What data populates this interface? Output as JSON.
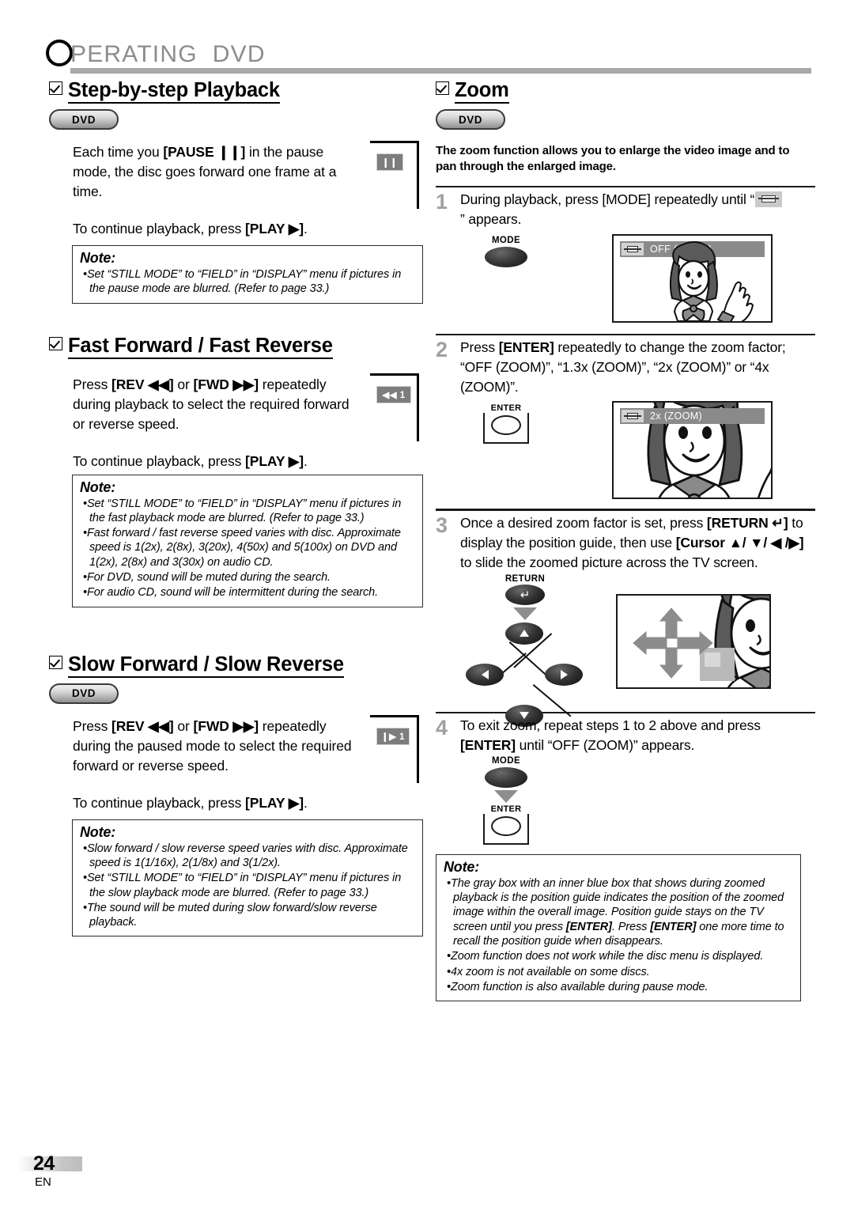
{
  "page": {
    "header_title": "PERATING  DVD",
    "header_initial": "O",
    "footer_page": "24",
    "footer_lang": "EN"
  },
  "left_column": {
    "sections": [
      {
        "title": "Step-by-step Playback",
        "badge": "DVD",
        "paragraphs": [
          "Each time you [PAUSE ❙❙] in the pause mode, the disc goes forward one frame at a time.",
          "To continue playback, press [PLAY ▶]."
        ],
        "key_chip": "❙❙",
        "note": {
          "title": "Note:",
          "items": [
            "Set “STILL MODE” to “FIELD” in “DISPLAY” menu if pictures in the pause mode are blurred. (Refer to page 33.)"
          ]
        }
      },
      {
        "title": "Fast Forward / Fast Reverse",
        "badge": null,
        "paragraphs": [
          "Press [REV ◀◀] or [FWD ▶▶] repeatedly during playback to select the required forward or reverse speed.",
          "To continue playback, press [PLAY ▶]."
        ],
        "key_chip": "◀◀ 1",
        "note": {
          "title": "Note:",
          "items": [
            "Set “STILL MODE” to “FIELD” in “DISPLAY” menu if pictures in the fast playback mode are blurred. (Refer to page 33.)",
            "Fast forward / fast reverse speed varies with disc. Approximate speed is 1(2x), 2(8x), 3(20x), 4(50x) and 5(100x) on DVD and 1(2x), 2(8x) and 3(30x) on audio CD.",
            "For DVD, sound will be muted during the search.",
            "For audio CD, sound will be intermittent during the search."
          ]
        }
      },
      {
        "title": "Slow Forward / Slow Reverse",
        "badge": "DVD",
        "paragraphs": [
          "Press [REV ◀◀] or [FWD ▶▶] repeatedly during the paused mode to select the required forward or reverse speed.",
          "To continue playback, press [PLAY ▶]."
        ],
        "key_chip": "❙▶ 1",
        "note": {
          "title": "Note:",
          "items": [
            "Slow forward / slow reverse speed varies with disc. Approximate speed is 1(1/16x), 2(1/8x) and 3(1/2x).",
            "Set “STILL MODE”  to “FIELD” in “DISPLAY” menu if pictures in the slow playback mode are blurred. (Refer to page 33.)",
            "The sound will be muted during slow forward/slow reverse playback."
          ]
        }
      }
    ]
  },
  "right_column": {
    "section": {
      "title": "Zoom",
      "badge": "DVD",
      "intro": "The zoom function allows you to enlarge the video image and to pan through the enlarged image."
    },
    "steps": [
      {
        "num": "1",
        "text_before": "During playback, press [MODE] repeatedly until “",
        "text_after": "” appears.",
        "button_label": "MODE",
        "screen": {
          "osd_text": "OFF  (ZOOM)"
        }
      },
      {
        "num": "2",
        "text": "Press [ENTER] repeatedly to change the zoom factor; “OFF (ZOOM)”, “1.3x (ZOOM)”, “2x (ZOOM)” or “4x (ZOOM)”.",
        "button_label": "ENTER",
        "screen": {
          "osd_text": "2x  (ZOOM)"
        }
      },
      {
        "num": "3",
        "text": "Once a desired zoom factor is set, press [RETURN ↵] to display the position guide, then use [Cursor ▲/ ▼/ ◀ /▶] to slide the zoomed picture across the TV screen.",
        "button_label": "RETURN"
      },
      {
        "num": "4",
        "text": "To exit zoom, repeat steps 1 to 2 above and press [ENTER] until “OFF (ZOOM)” appears.",
        "button_label_1": "MODE",
        "button_label_2": "ENTER"
      }
    ],
    "note": {
      "title": "Note:",
      "items": [
        "The gray box with an inner blue box that shows during zoomed playback is the position guide indicates the position of the zoomed image within the overall image. Position guide stays on the TV screen until you press [ENTER]. Press [ENTER] one more time to recall the position guide when disappears.",
        "Zoom function does not work while the disc menu is displayed.",
        "4x zoom is not available on some discs.",
        "Zoom function is also available during pause mode."
      ]
    }
  }
}
